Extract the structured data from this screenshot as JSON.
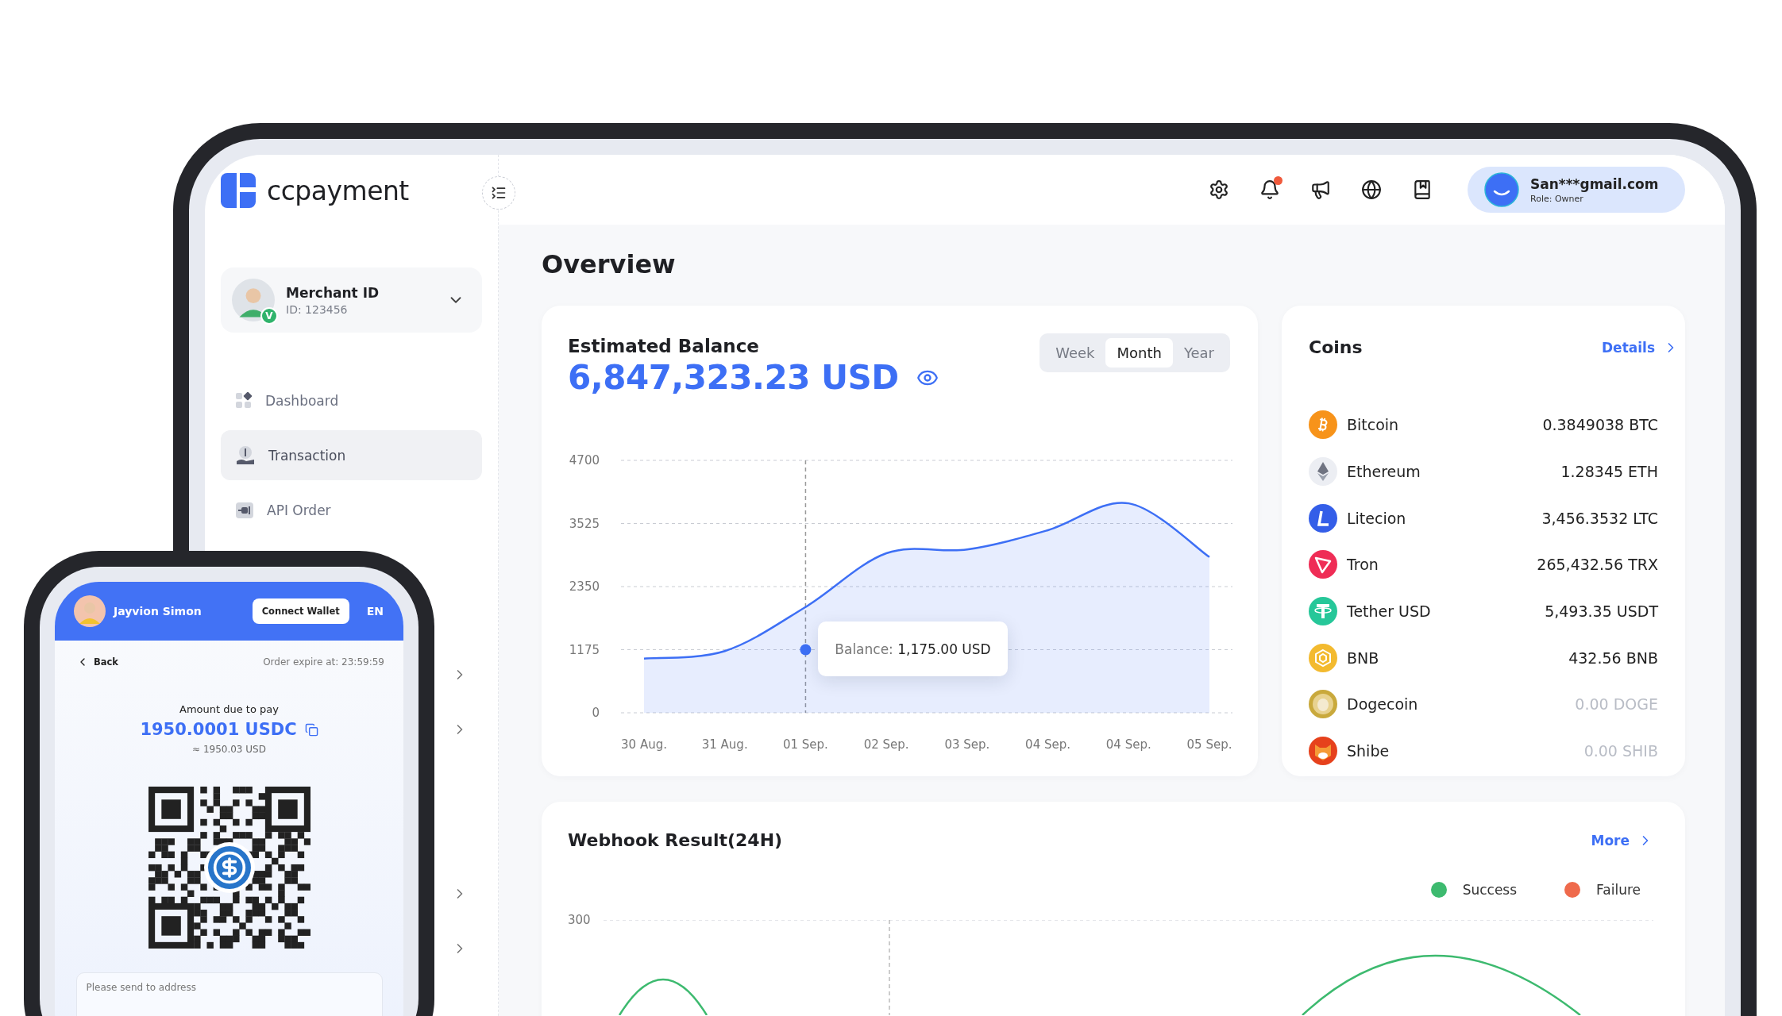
{
  "tablet": {
    "brand": "ccpayment",
    "merchant": {
      "name": "Merchant ID",
      "id": "ID: 123456",
      "badge": "V"
    },
    "nav": [
      {
        "label": "Dashboard",
        "selected": false
      },
      {
        "label": "Transaction",
        "selected": true
      },
      {
        "label": "API Order",
        "selected": false
      }
    ],
    "header": {
      "notification": true,
      "user": {
        "email": "San***gmail.com",
        "role": "Role: Owner"
      }
    },
    "title": "Overview",
    "balance": {
      "title": "Estimated Balance",
      "amount": "6,847,323.23 USD",
      "periods": [
        {
          "label": "Week",
          "selected": false
        },
        {
          "label": "Month",
          "selected": true
        },
        {
          "label": "Year",
          "selected": false
        }
      ],
      "chart_data": {
        "type": "area",
        "categories": [
          "30 Aug.",
          "31 Aug.",
          "01 Sep.",
          "02 Sep.",
          "03 Sep.",
          "04 Sep.",
          "04 Sep.",
          "05 Sep."
        ],
        "series": [
          {
            "color": "#3d6ff5",
            "values": [
              1010,
              1150,
              1970,
              2970,
              3040,
              3400,
              3900,
              2900
            ]
          }
        ],
        "ylim": [
          0,
          4700
        ],
        "yticks": [
          0,
          1175,
          2350,
          3525,
          4700
        ],
        "grid": true,
        "ref_lines": [
          {
            "axis": "x",
            "value": "01 Sep."
          }
        ],
        "annotations": [
          {
            "x": "01 Sep.",
            "y": 1175,
            "text": "Balance: **1,175.00 USD**"
          }
        ]
      }
    },
    "coins": {
      "title": "Coins",
      "link": "Details",
      "items": [
        {
          "name": "Bitcoin",
          "amount": "0.3849038 BTC",
          "color": "#f7931a",
          "muted": false
        },
        {
          "name": "Ethereum",
          "amount": "1.28345 ETH",
          "color": "#eceef3",
          "muted": false
        },
        {
          "name": "Litecion",
          "amount": "3,456.3532 LTC",
          "color": "#345ee8",
          "muted": false
        },
        {
          "name": "Tron",
          "amount": "265,432.56 TRX",
          "color": "#ef2d56",
          "muted": false
        },
        {
          "name": "Tether USD",
          "amount": "5,493.35 USDT",
          "color": "#26c799",
          "muted": false
        },
        {
          "name": "BNB",
          "amount": "432.56 BNB",
          "color": "#f3ba2f",
          "muted": false
        },
        {
          "name": "Dogecoin",
          "amount": "0.00 DOGE",
          "color": "#c9a93c",
          "muted": true
        },
        {
          "name": "Shibe",
          "amount": "0.00 SHIB",
          "color": "#e6411c",
          "muted": true
        }
      ]
    },
    "webhook": {
      "title": "Webhook Result(24H)",
      "link": "More",
      "legend": [
        {
          "label": "Success",
          "color": "#3dba6f"
        },
        {
          "label": "Failure",
          "color": "#ef6a4c"
        }
      ],
      "y_tick": "300"
    }
  },
  "phone": {
    "user": "Jayvion Simon",
    "connect": "Connect Wallet",
    "language": "EN",
    "back": "Back",
    "expire": "Order expire at: 23:59:59",
    "amount_label": "Amount due to pay",
    "amount": "1950.0001 USDC",
    "approx": "≈ 1950.03 USD",
    "address_label": "Please send to address"
  }
}
